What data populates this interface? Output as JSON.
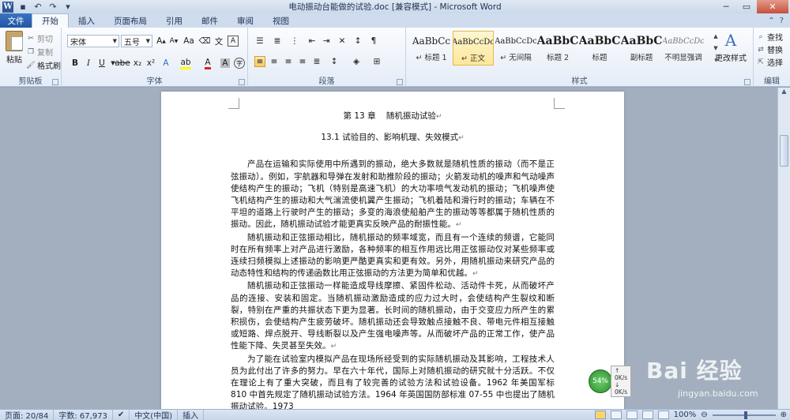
{
  "window": {
    "title": "电动振动台能做的试验.doc [兼容模式] - Microsoft Word",
    "qat": [
      "word-icon",
      "save-icon",
      "undo-icon",
      "redo-icon",
      "customize-icon"
    ]
  },
  "tabs": [
    "文件",
    "开始",
    "插入",
    "页面布局",
    "引用",
    "邮件",
    "审阅",
    "视图"
  ],
  "ribbon": {
    "clipboard": {
      "label": "剪贴板",
      "paste": "粘贴",
      "cut": "剪切",
      "copy": "复制",
      "format_painter": "格式刷"
    },
    "font": {
      "label": "字体",
      "font_name": "宋体",
      "font_size": "五号",
      "text_A": "A",
      "wen": "文",
      "font_color": "#e02020",
      "highlight_color": "#ffff00"
    },
    "paragraph": {
      "label": "段落"
    },
    "styles": {
      "label": "样式",
      "items": [
        {
          "sample": "AaBbCc",
          "name": "↵ 标题 1"
        },
        {
          "sample": "AaBbCcDc",
          "name": "↵ 正文"
        },
        {
          "sample": "AaBbCcDc",
          "name": "↵ 无间隔"
        },
        {
          "sample": "AaBbC",
          "name": "标题 2"
        },
        {
          "sample": "AaBbC",
          "name": "标题"
        },
        {
          "sample": "AaBbC",
          "name": "副标题"
        },
        {
          "sample": "AaBbCcDc",
          "name": "不明显强调"
        }
      ],
      "change_styles": "更改样式"
    },
    "editing": {
      "label": "编辑",
      "find": "查找",
      "replace": "替换",
      "select": "选择"
    }
  },
  "document": {
    "chapter_title": "第 13 章    随机振动试验",
    "section_title": "13.1  试验目的、影响机理、失效模式",
    "paragraphs": [
      "产品在运输和实际使用中所遇到的振动，绝大多数就是随机性质的振动（而不是正弦振动）。例如，宇航器和导弹在发射和助推阶段的振动；火箭发动机的噪声和气动噪声使结构产生的振动；飞机（特别是高速飞机）的大功率喷气发动机的振动；飞机噪声使飞机结构产生的振动和大气湍流使机翼产生振动；飞机着陆和滑行时的振动；车辆在不平坦的道路上行驶时产生的振动；多变的海浪使船舶产生的振动等等都属于随机性质的振动。因此，随机振动试验才能更真实反映产品的耐振性能。",
      "随机振动和正弦振动相比，随机振动的频率域宽，而且有一个连续的频谱，它能同时在所有频率上对产品进行激励，各种频率的相互作用远比用正弦振动仅对某些频率或连续扫频模拟上述振动的影响更严酷更真实和更有效。另外，用随机振动来研究产品的动态特性和结构的传递函数比用正弦振动的方法更为简单和优越。",
      "随机振动和正弦振动一样能造成导线摩擦、紧固件松动、活动件卡死，从而破坏产品的连接、安装和固定。当随机振动激励造成的应力过大时，会使结构产生裂纹和断裂，特别在严重的共振状态下更为显著。长时间的随机振动，由于交变应力所产生的累积损伤，会使结构产生疲劳破坏。随机振动还会导致触点接触不良、带电元件相互接触或短路、焊点脱开、导线断裂以及产生强电噪声等。从而破坏产品的正常工作，使产品性能下降、失灵甚至失效。",
      "为了能在试验室内模拟产品在现场所经受到的实际随机振动及其影响，工程技术人员为此付出了许多的努力。早在六十年代，国际上对随机振动的研究就十分活跃。不仅在理论上有了重大突破，而且有了较完善的试验方法和试验设备。1962 年美国军标 810 中首先规定了随机振动试验方法。1964 年英国国防部标准 07-55 中也提出了随机振动试验。1973"
    ]
  },
  "statusbar": {
    "page": "页面: 20/84",
    "words": "字数: 67,973",
    "language": "中文(中国)",
    "mode": "插入",
    "zoom": "100%"
  },
  "netmeter": {
    "percent": "54%",
    "up": "0K/s",
    "down": "0K/s"
  },
  "watermark": {
    "logo": "Bai 经验",
    "url": "jingyan.baidu.com"
  }
}
